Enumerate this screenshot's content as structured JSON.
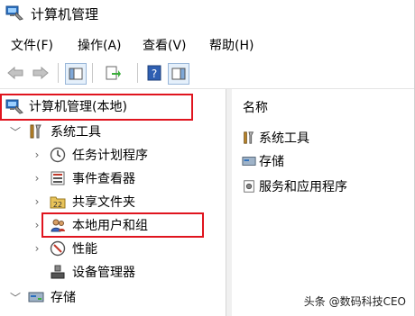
{
  "window": {
    "title": "计算机管理"
  },
  "menu": {
    "items": [
      "文件(F)",
      "操作(A)",
      "查看(V)",
      "帮助(H)"
    ]
  },
  "toolbar": {
    "icons": [
      "back-icon",
      "forward-icon",
      "show-hide-tree-icon",
      "export-list-icon",
      "help-icon",
      "view-icon"
    ]
  },
  "tree": {
    "root": "计算机管理(本地)",
    "system_tools": "系统工具",
    "task_scheduler": "任务计划程序",
    "event_viewer": "事件查看器",
    "shared_folders": "共享文件夹",
    "local_users": "本地用户和组",
    "performance": "性能",
    "device_manager": "设备管理器",
    "storage": "存储"
  },
  "right": {
    "column_header": "名称",
    "items": [
      "系统工具",
      "存储",
      "服务和应用程序"
    ]
  },
  "watermark": "头条 @数码科技CEO",
  "colors": {
    "highlight": "#e0141e"
  }
}
